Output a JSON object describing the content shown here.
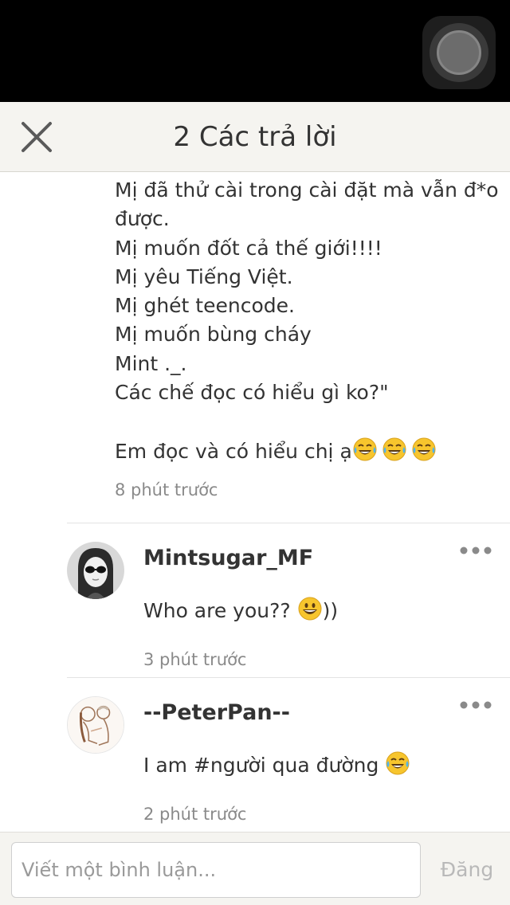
{
  "header": {
    "title": "2 Các trả lời",
    "close_icon": "close-icon"
  },
  "main_comment": {
    "lines": [
      "Mị đã thử cài trong cài đặt mà vẫn đ*o",
      "được.",
      "Mị muốn đốt cả thế giới!!!!",
      "Mị yêu Tiếng Việt.",
      "Mị ghét teencode.",
      "Mị muốn bùng cháy",
      "Mint ._.",
      "Các chế đọc có hiểu gì ko?\""
    ],
    "reply_line": "Em đọc và có hiểu chị ạ",
    "reply_emojis": [
      "tears-of-joy-emoji",
      "tears-of-joy-emoji",
      "tears-of-joy-emoji"
    ],
    "time": "8 phút trước"
  },
  "replies": [
    {
      "name": "Mintsugar_MF",
      "text_before": "Who are you?? ",
      "emoji": "grinning-face-emoji",
      "text_after": "))",
      "time": "3 phút trước",
      "more_icon": "more-dots-icon"
    },
    {
      "name": "--PeterPan--",
      "text_before": "I am #người qua đường ",
      "emoji": "tears-of-joy-emoji",
      "text_after": "",
      "time": "2 phút trước",
      "more_icon": "more-dots-icon"
    }
  ],
  "composer": {
    "placeholder": "Viết một bình luận...",
    "value": "",
    "post_label": "Đăng"
  },
  "colors": {
    "header_bg": "#f5f4f0",
    "text": "#333333",
    "muted": "#8a8a8a",
    "post_disabled": "#b9b9b9",
    "emoji_yellow": "#f7c52d"
  }
}
